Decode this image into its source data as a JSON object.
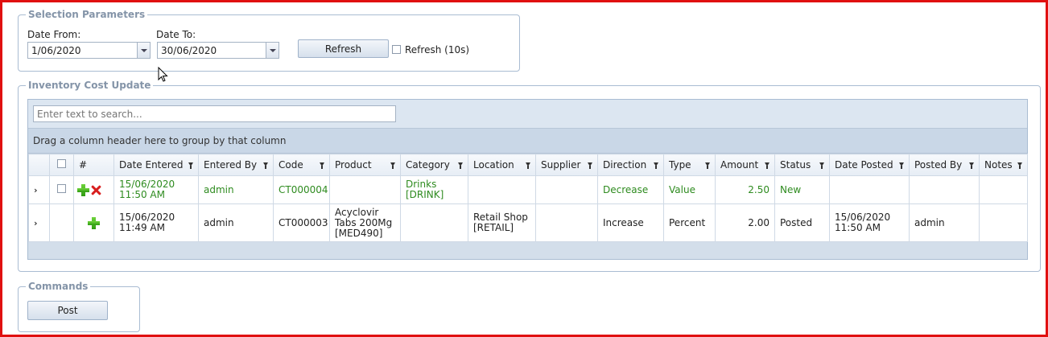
{
  "selection": {
    "legend": "Selection Parameters",
    "date_from_label": "Date From:",
    "date_from_value": "1/06/2020",
    "date_to_label": "Date To:",
    "date_to_value": "30/06/2020",
    "refresh_label": "Refresh",
    "auto_refresh_label": "Refresh (10s)"
  },
  "inventory": {
    "legend": "Inventory Cost Update",
    "search_placeholder": "Enter text to search...",
    "group_hint": "Drag a column header here to group by that column",
    "columns": [
      "#",
      "Date Entered",
      "Entered By",
      "Code",
      "Product",
      "Category",
      "Location",
      "Supplier",
      "Direction",
      "Type",
      "Amount",
      "Status",
      "Date Posted",
      "Posted By",
      "Notes"
    ],
    "rows": [
      {
        "date_entered_1": "15/06/2020",
        "date_entered_2": "11:50 AM",
        "entered_by": "admin",
        "code": "CT000004",
        "product_1": "",
        "product_2": "",
        "product_3": "",
        "category_1": "Drinks",
        "category_2": "[DRINK]",
        "location_1": "",
        "location_2": "",
        "supplier": "",
        "direction": "Decrease",
        "type": "Value",
        "amount": "2.50",
        "status": "New",
        "date_posted_1": "",
        "date_posted_2": "",
        "posted_by": "",
        "notes": ""
      },
      {
        "date_entered_1": "15/06/2020",
        "date_entered_2": "11:49 AM",
        "entered_by": "admin",
        "code": "CT000003",
        "product_1": "Acyclovir",
        "product_2": "Tabs 200Mg",
        "product_3": "[MED490]",
        "category_1": "",
        "category_2": "",
        "location_1": "Retail Shop",
        "location_2": "[RETAIL]",
        "supplier": "",
        "direction": "Increase",
        "type": "Percent",
        "amount": "2.00",
        "status": "Posted",
        "date_posted_1": "15/06/2020",
        "date_posted_2": "11:50 AM",
        "posted_by": "admin",
        "notes": ""
      }
    ]
  },
  "commands": {
    "legend": "Commands",
    "post_label": "Post"
  },
  "colors": {
    "frame_border": "#e01010",
    "new_row_text": "#2e8b1f",
    "legend_text": "#8494a8"
  }
}
